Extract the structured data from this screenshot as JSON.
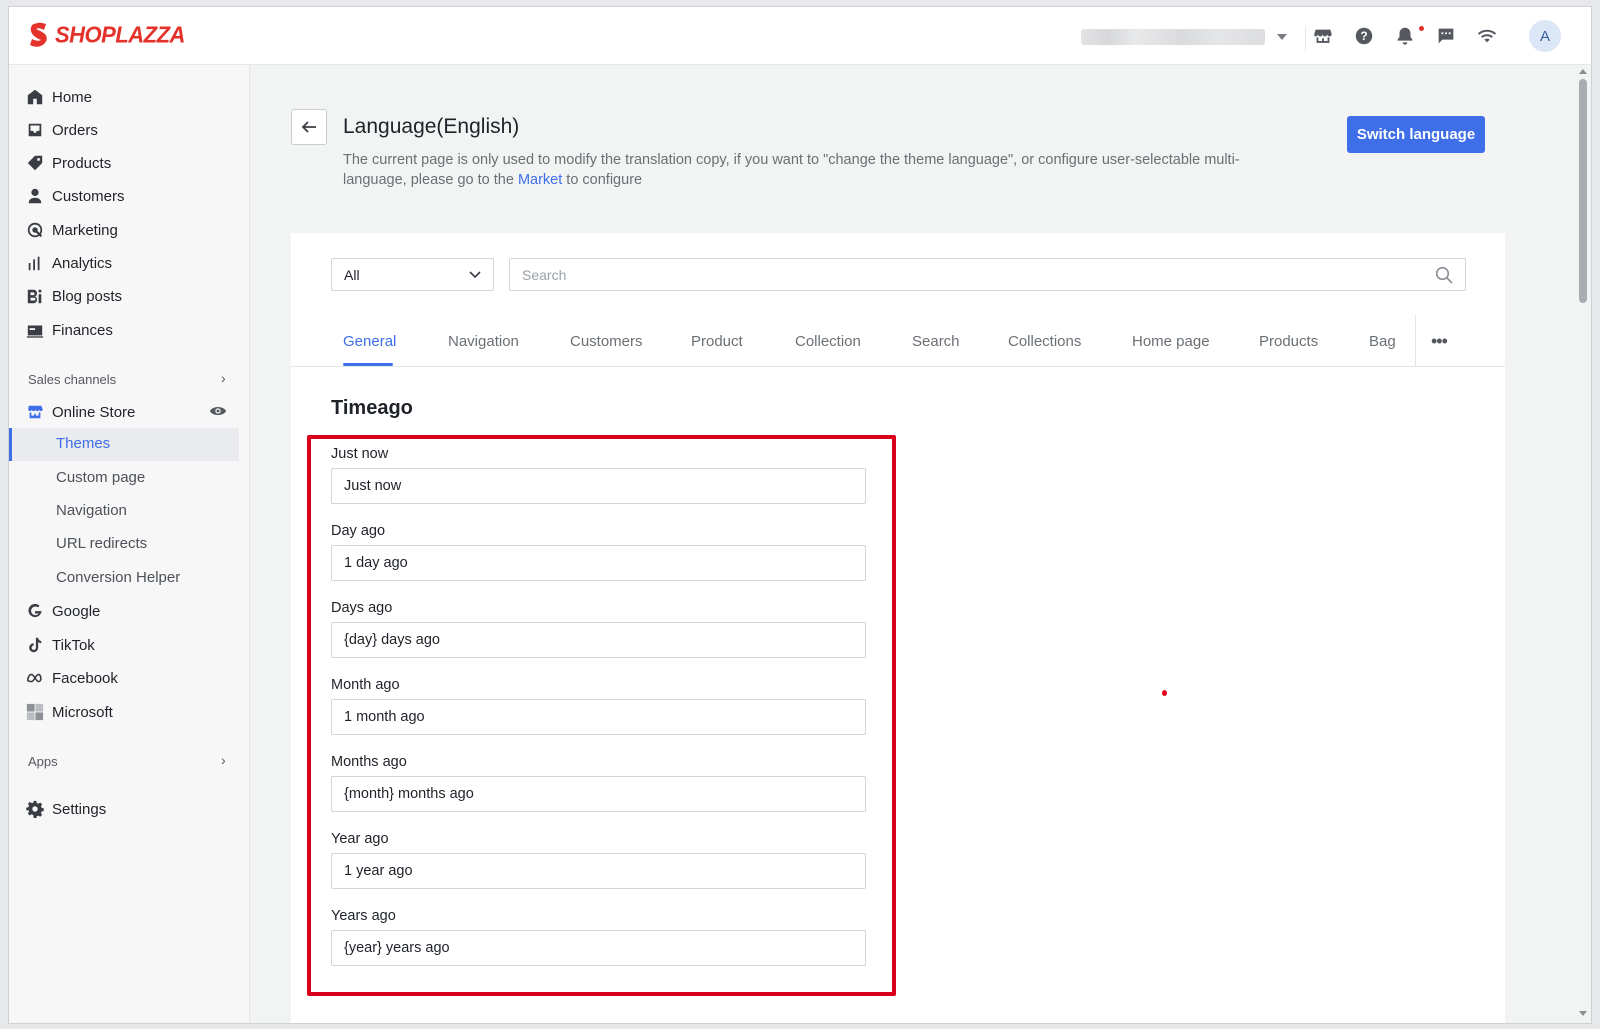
{
  "brand": {
    "name": "SHOPLAZZA",
    "color": "#e4322b",
    "accent": "#3e6ee8",
    "highlight": "#d9001b"
  },
  "topbar": {
    "icons": [
      "store-icon",
      "help-icon",
      "bell-icon",
      "chat-icon",
      "wifi-icon"
    ],
    "avatar_letter": "A"
  },
  "sidebar": {
    "main_items": [
      {
        "label": "Home",
        "icon": "home-icon"
      },
      {
        "label": "Orders",
        "icon": "orders-icon"
      },
      {
        "label": "Products",
        "icon": "tag-icon"
      },
      {
        "label": "Customers",
        "icon": "person-icon"
      },
      {
        "label": "Marketing",
        "icon": "marketing-icon"
      },
      {
        "label": "Analytics",
        "icon": "bar-chart-icon"
      },
      {
        "label": "Blog posts",
        "icon": "blog-icon"
      },
      {
        "label": "Finances",
        "icon": "finance-icon"
      }
    ],
    "sales_channels_label": "Sales channels",
    "online_store_label": "Online Store",
    "online_store_sub": [
      "Themes",
      "Custom page",
      "Navigation",
      "URL redirects",
      "Conversion Helper"
    ],
    "channels": [
      {
        "label": "Google",
        "icon": "google-icon"
      },
      {
        "label": "TikTok",
        "icon": "tiktok-icon"
      },
      {
        "label": "Facebook",
        "icon": "meta-icon"
      },
      {
        "label": "Microsoft",
        "icon": "microsoft-icon"
      }
    ],
    "apps_label": "Apps",
    "settings_label": "Settings"
  },
  "page": {
    "title": "Language(English)",
    "description_before": "The current page is only used to modify the translation copy, if you want to \"change the theme language\", or configure user-selectable multi-language, please go to the ",
    "description_link": "Market",
    "description_after": " to configure",
    "switch_button": "Switch language"
  },
  "filter": {
    "selected": "All"
  },
  "search": {
    "placeholder": "Search",
    "value": ""
  },
  "tabs": [
    "General",
    "Navigation",
    "Customers",
    "Product",
    "Collection",
    "Search",
    "Collections",
    "Home page",
    "Products",
    "Bag"
  ],
  "active_tab": "General",
  "section": {
    "title": "Timeago",
    "fields": [
      {
        "label": "Just now",
        "value": "Just now"
      },
      {
        "label": "Day ago",
        "value": "1 day ago"
      },
      {
        "label": "Days ago",
        "value": "{day} days ago"
      },
      {
        "label": "Month ago",
        "value": "1 month ago"
      },
      {
        "label": "Months ago",
        "value": "{month} months ago"
      },
      {
        "label": "Year ago",
        "value": "1 year ago"
      },
      {
        "label": "Years ago",
        "value": "{year} years ago"
      }
    ]
  }
}
